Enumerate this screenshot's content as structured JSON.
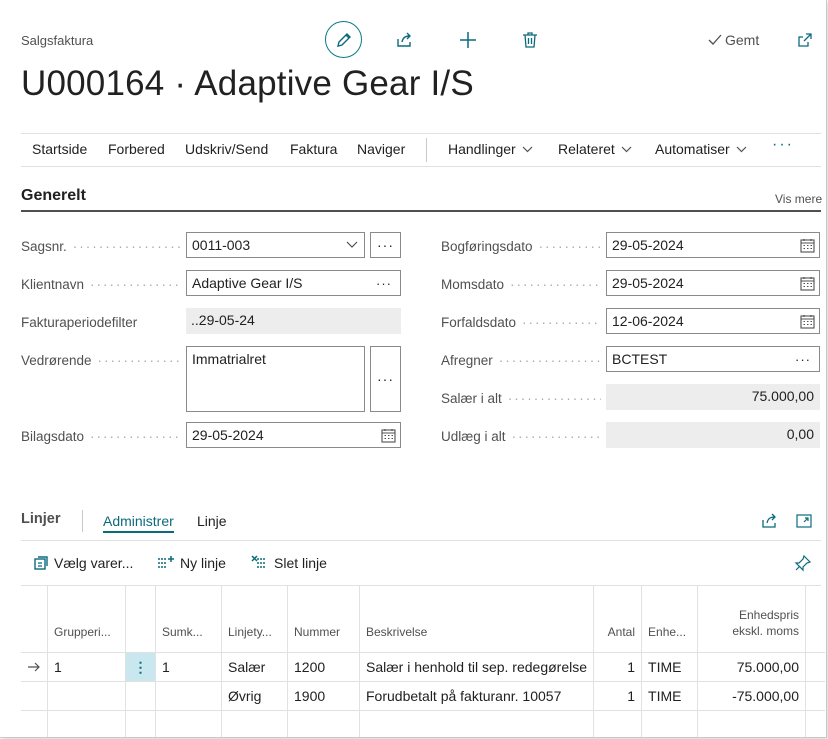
{
  "header": {
    "breadcrumb": "Salgsfaktura",
    "title": "U000164 · Adaptive Gear I/S",
    "saved_label": "Gemt"
  },
  "actions": [
    {
      "label": "Startside"
    },
    {
      "label": "Forbered"
    },
    {
      "label": "Udskriv/Send"
    },
    {
      "label": "Faktura"
    },
    {
      "label": "Naviger"
    },
    {
      "label": "Handlinger"
    },
    {
      "label": "Relateret"
    },
    {
      "label": "Automatiser"
    }
  ],
  "general": {
    "title": "Generelt",
    "show_more": "Vis mere",
    "fields": {
      "sagsnr": {
        "label": "Sagsnr.",
        "value": "0011-003"
      },
      "klientnavn": {
        "label": "Klientnavn",
        "value": "Adaptive Gear I/S"
      },
      "fakturaperiodefilter": {
        "label": "Fakturaperiodefilter",
        "value": "..29-05-24"
      },
      "vedroerende": {
        "label": "Vedrørende",
        "value": "Immatrialret"
      },
      "bilagsdato": {
        "label": "Bilagsdato",
        "value": "29-05-2024"
      },
      "bogfoeringsdato": {
        "label": "Bogføringsdato",
        "value": "29-05-2024"
      },
      "momsdato": {
        "label": "Momsdato",
        "value": "29-05-2024"
      },
      "forfaldsdato": {
        "label": "Forfaldsdato",
        "value": "12-06-2024"
      },
      "afregner": {
        "label": "Afregner",
        "value": "BCTEST"
      },
      "salaer": {
        "label": "Salær i alt",
        "value": "75.000,00"
      },
      "udlaeg": {
        "label": "Udlæg i alt",
        "value": "0,00"
      }
    }
  },
  "lines": {
    "title": "Linjer",
    "tabs": [
      "Administrer",
      "Linje"
    ],
    "toolbar": {
      "choose_items": "Vælg varer...",
      "new_line": "Ny linje",
      "delete_line": "Slet linje"
    },
    "columns": [
      "Grupperi...",
      "Sumk...",
      "Linjety...",
      "Nummer",
      "Beskrivelse",
      "Antal",
      "Enhe...",
      "Enhedspris",
      "ekskl. moms"
    ],
    "rows": [
      {
        "gruppering": "1",
        "sumkode": "1",
        "type": "Salær",
        "nummer": "1200",
        "beskrivelse": "Salær i henhold til sep. redegørelse",
        "antal": "1",
        "enhed": "TIME",
        "pris": "75.000,00"
      },
      {
        "gruppering": "",
        "sumkode": "",
        "type": "Øvrig",
        "nummer": "1900",
        "beskrivelse": "Forudbetalt på fakturanr. 10057",
        "antal": "1",
        "enhed": "TIME",
        "pris": "-75.000,00"
      }
    ]
  },
  "colors": {
    "accent": "#0b6a7e",
    "selected_cell": "#c9e7ef",
    "readonly_bg": "#ededed"
  }
}
